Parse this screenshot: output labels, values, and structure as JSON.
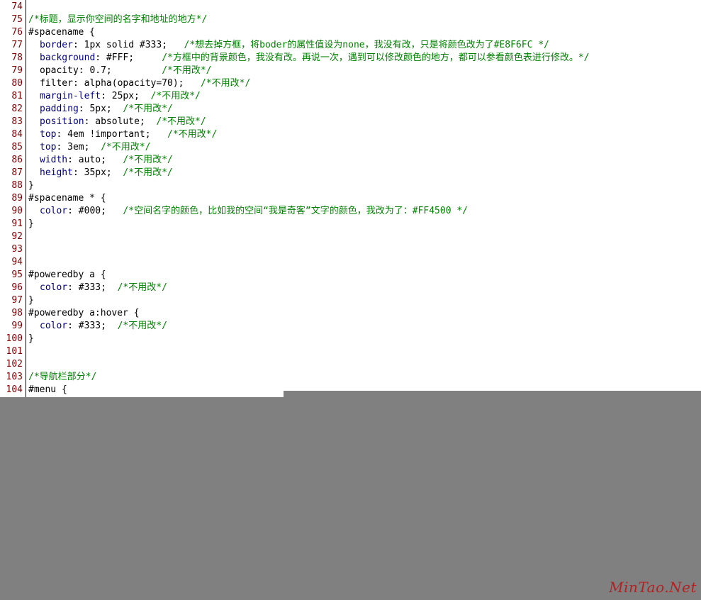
{
  "editor": {
    "lines": [
      {
        "num": "74",
        "parts": []
      },
      {
        "num": "75",
        "parts": [
          {
            "t": "/*标题，显示你空间的名字和地址的地方*/",
            "c": "cmt"
          }
        ]
      },
      {
        "num": "76",
        "parts": [
          {
            "t": "#spacename {",
            "c": "sel"
          }
        ]
      },
      {
        "num": "77",
        "indent": true,
        "parts": [
          {
            "t": "border",
            "c": "prop"
          },
          {
            "t": ": 1px solid #333;   ",
            "c": "val"
          },
          {
            "t": "/*想去掉方框，将boder的属性值设为none，我没有改，只是将颜色改为了#E8F6FC */",
            "c": "cmt"
          }
        ]
      },
      {
        "num": "78",
        "indent": true,
        "parts": [
          {
            "t": "background",
            "c": "prop"
          },
          {
            "t": ": #FFF;     ",
            "c": "val"
          },
          {
            "t": "/*方框中的背景颜色，我没有改。再说一次，遇到可以修改颜色的地方，都可以参看颜色表进行修改。*/",
            "c": "cmt"
          }
        ]
      },
      {
        "num": "79",
        "indent": true,
        "parts": [
          {
            "t": "opacity: 0.7;         ",
            "c": "val"
          },
          {
            "t": "/*不用改*/",
            "c": "cmt"
          }
        ]
      },
      {
        "num": "80",
        "indent": true,
        "parts": [
          {
            "t": "filter: alpha(opacity=70);   ",
            "c": "val"
          },
          {
            "t": "/*不用改*/",
            "c": "cmt"
          }
        ]
      },
      {
        "num": "81",
        "indent": true,
        "parts": [
          {
            "t": "margin-left",
            "c": "prop"
          },
          {
            "t": ": 25px;  ",
            "c": "val"
          },
          {
            "t": "/*不用改*/",
            "c": "cmt"
          }
        ]
      },
      {
        "num": "82",
        "indent": true,
        "parts": [
          {
            "t": "padding",
            "c": "prop"
          },
          {
            "t": ": 5px;  ",
            "c": "val"
          },
          {
            "t": "/*不用改*/",
            "c": "cmt"
          }
        ]
      },
      {
        "num": "83",
        "indent": true,
        "parts": [
          {
            "t": "position",
            "c": "prop"
          },
          {
            "t": ": absolute;  ",
            "c": "val"
          },
          {
            "t": "/*不用改*/",
            "c": "cmt"
          }
        ]
      },
      {
        "num": "84",
        "indent": true,
        "parts": [
          {
            "t": "top",
            "c": "prop"
          },
          {
            "t": ": 4em !important;   ",
            "c": "val"
          },
          {
            "t": "/*不用改*/",
            "c": "cmt"
          }
        ]
      },
      {
        "num": "85",
        "indent": true,
        "parts": [
          {
            "t": "top",
            "c": "prop"
          },
          {
            "t": ": 3em;  ",
            "c": "val"
          },
          {
            "t": "/*不用改*/",
            "c": "cmt"
          }
        ]
      },
      {
        "num": "86",
        "indent": true,
        "parts": [
          {
            "t": "width",
            "c": "prop"
          },
          {
            "t": ": auto;   ",
            "c": "val"
          },
          {
            "t": "/*不用改*/",
            "c": "cmt"
          }
        ]
      },
      {
        "num": "87",
        "indent": true,
        "parts": [
          {
            "t": "height",
            "c": "prop"
          },
          {
            "t": ": 35px;  ",
            "c": "val"
          },
          {
            "t": "/*不用改*/",
            "c": "cmt"
          }
        ]
      },
      {
        "num": "88",
        "parts": [
          {
            "t": "}",
            "c": "punc"
          }
        ]
      },
      {
        "num": "89",
        "parts": [
          {
            "t": "#spacename * {",
            "c": "sel"
          }
        ]
      },
      {
        "num": "90",
        "indent": true,
        "parts": [
          {
            "t": "color",
            "c": "prop"
          },
          {
            "t": ": #000;   ",
            "c": "val"
          },
          {
            "t": "/*空间名字的颜色，比如我的空间“我是奇客”文字的颜色，我改为了：#FF4500 */",
            "c": "cmt"
          }
        ]
      },
      {
        "num": "91",
        "parts": [
          {
            "t": "}",
            "c": "punc"
          }
        ]
      },
      {
        "num": "92",
        "parts": []
      },
      {
        "num": "93",
        "parts": []
      },
      {
        "num": "94",
        "parts": []
      },
      {
        "num": "95",
        "parts": [
          {
            "t": "#poweredby a {",
            "c": "sel"
          }
        ]
      },
      {
        "num": "96",
        "indent": true,
        "parts": [
          {
            "t": "color",
            "c": "prop"
          },
          {
            "t": ": #333;  ",
            "c": "val"
          },
          {
            "t": "/*不用改*/",
            "c": "cmt"
          }
        ]
      },
      {
        "num": "97",
        "parts": [
          {
            "t": "}",
            "c": "punc"
          }
        ]
      },
      {
        "num": "98",
        "parts": [
          {
            "t": "#poweredby a:hover {",
            "c": "sel"
          }
        ]
      },
      {
        "num": "99",
        "indent": true,
        "parts": [
          {
            "t": "color",
            "c": "prop"
          },
          {
            "t": ": #333;  ",
            "c": "val"
          },
          {
            "t": "/*不用改*/",
            "c": "cmt"
          }
        ]
      },
      {
        "num": "100",
        "parts": [
          {
            "t": "}",
            "c": "punc"
          }
        ]
      },
      {
        "num": "101",
        "parts": []
      },
      {
        "num": "102",
        "parts": []
      },
      {
        "num": "103",
        "parts": [
          {
            "t": "/*导航栏部分*/",
            "c": "cmt"
          }
        ]
      },
      {
        "num": "104",
        "parts": [
          {
            "t": "#menu {",
            "c": "sel"
          }
        ]
      }
    ]
  },
  "watermark": {
    "text": "MinTao.Net"
  },
  "colors": {
    "line_number": "#800000",
    "property": "#000080",
    "comment": "#008000",
    "text": "#000000",
    "background_empty": "#808080",
    "watermark": "#b22222"
  }
}
